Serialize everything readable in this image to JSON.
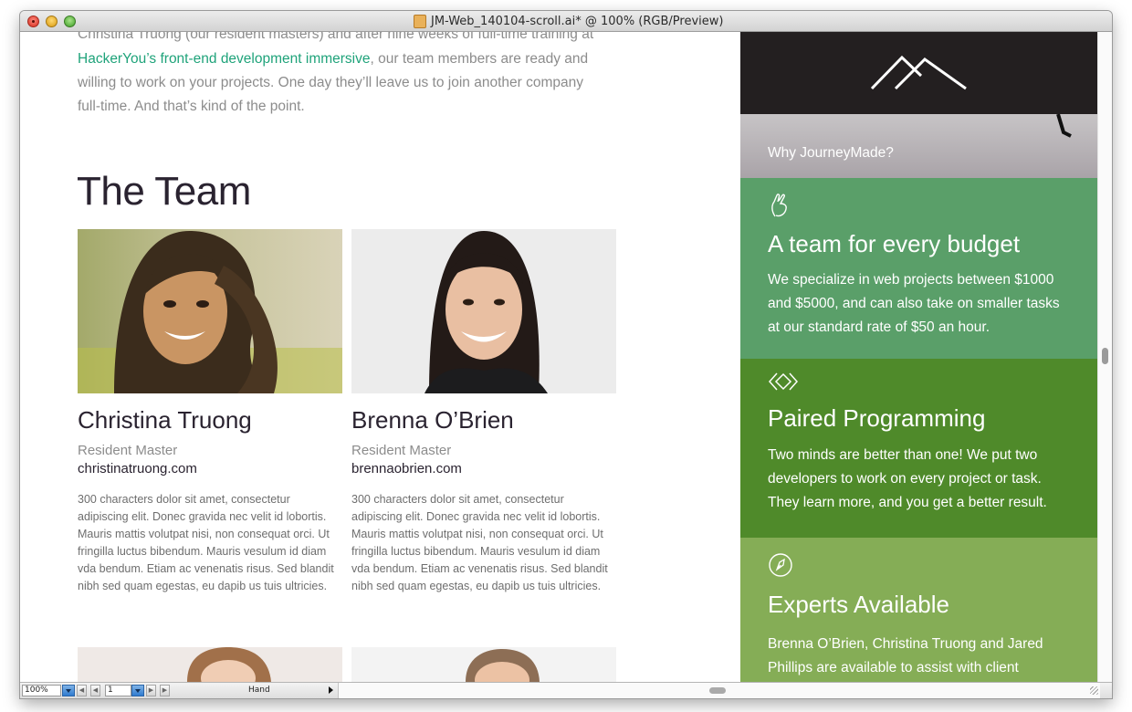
{
  "window": {
    "title": "JM-Web_140104-scroll.ai* @ 100% (RGB/Preview)"
  },
  "intro": {
    "line1": "Christina Truong (our resident masters) and after nine weeks of full-time training at",
    "link": "HackerYou’s front-end development immersive",
    "rest": ", our team members are ready and willing to work on your projects. One day they’ll leave us to join another company full-time. And that’s kind of the point."
  },
  "team": {
    "heading": "The Team",
    "members": [
      {
        "name": "Christina Truong",
        "role": "Resident Master",
        "site": "christinatruong.com",
        "bio": "300 characters dolor sit amet, consectetur adipiscing elit. Donec gravida nec velit id lobortis. Mauris mattis volutpat nisi, non consequat orci. Ut fringilla luctus bibendum. Mauris vesulum id diam vda bendum. Etiam ac venenatis risus. Sed blandit nibh sed quam egestas, eu dapib us tuis ultricies."
      },
      {
        "name": "Brenna O’Brien",
        "role": "Resident Master",
        "site": "brennaobrien.com",
        "bio": "300 characters dolor sit amet, consectetur adipiscing elit. Donec gravida nec velit id lobortis. Mauris mattis volutpat nisi, non consequat orci. Ut fringilla luctus bibendum. Mauris vesulum id diam vda bendum. Etiam ac venenatis risus. Sed blandit nibh sed quam egestas, eu dapib us tuis ultricies."
      }
    ]
  },
  "sidebar": {
    "hero_text": "Why JourneyMade?",
    "panels": [
      {
        "title": "A team for every budget",
        "body": "We specialize in web projects between $1000 and $5000, and can also take on smaller tasks at our standard rate of $50 an hour.",
        "icon": "hand-icon",
        "color": "#5a9f69"
      },
      {
        "title": "Paired Programming",
        "body": "Two minds are better than one! We put two developers to work on every project or task. They learn more, and you get a better result.",
        "icon": "diamonds-icon",
        "color": "#4f8a2a"
      },
      {
        "title": "Experts Available",
        "body": "Brenna O’Brien, Christina Truong and Jared Phillips are available to assist with client",
        "icon": "pen-nib-icon",
        "color": "#85ad56"
      }
    ]
  },
  "statusbar": {
    "zoom": "100%",
    "page": "1",
    "tool": "Hand"
  }
}
